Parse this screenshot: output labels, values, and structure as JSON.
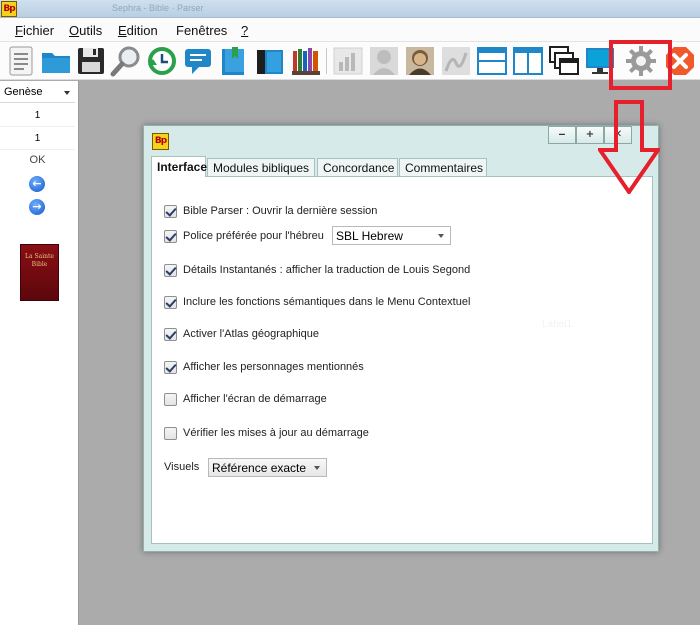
{
  "window": {
    "logo_text": "Bp",
    "ghost_title": "Sephra - Bible  ·  Parser"
  },
  "menu": [
    {
      "underlined": "F",
      "rest": "ichier"
    },
    {
      "underlined": "O",
      "rest": "utils"
    },
    {
      "underlined": "E",
      "rest": "dition"
    },
    {
      "underlined": "",
      "rest": "Fenêtres"
    },
    {
      "underlined": "?",
      "rest": ""
    }
  ],
  "toolbar": {
    "icons": [
      "document-icon",
      "folder-icon",
      "save-icon",
      "search-icon",
      "history-clock-icon",
      "comment-bubble-icon",
      "bookmark-book-icon",
      "books-icon",
      "library-books-icon",
      "chart-icon",
      "portrait-icon",
      "person-portrait-icon",
      "sketch-icon",
      "single-window-icon",
      "split-window-icon",
      "cascade-windows-icon",
      "monitor-icon",
      "gear-icon",
      "close-icon"
    ],
    "colors": {
      "blue": "#1f86c8",
      "green": "#2ba04a",
      "red_close": "#f0592a"
    }
  },
  "left_panel": {
    "book": "Genèse",
    "chapter": "1",
    "verse": "1",
    "ok_label": "OK",
    "bible_cover_line1": "La Sainte",
    "bible_cover_line2": "Bible"
  },
  "dialog": {
    "logo_text": "Bp",
    "window_buttons": [
      "‒",
      "+",
      "✕"
    ],
    "tabs": [
      "Interface",
      "Modules bibliques",
      "Concordance",
      "Commentaires"
    ],
    "active_tab": "Interface",
    "options": [
      {
        "label": "Bible Parser : Ouvrir la dernière session",
        "checked": true
      },
      {
        "label": "Police préférée pour l'hébreu",
        "checked": true
      },
      {
        "label": "Détails Instantanés : afficher la traduction de Louis Segond",
        "checked": true
      },
      {
        "label": "Inclure les fonctions sémantiques dans le Menu Contextuel",
        "checked": true
      },
      {
        "label": "Activer l'Atlas géographique",
        "checked": true
      },
      {
        "label": "Afficher les personnages mentionnés",
        "checked": true
      },
      {
        "label": "Afficher l'écran de démarrage",
        "checked": false
      },
      {
        "label": "Vérifier les mises à jour au démarrage",
        "checked": false
      }
    ],
    "hebrew_font": "SBL Hebrew",
    "visuels_label": "Visuels",
    "visuels_value": "Référence exacte",
    "ghost_label": "Label1"
  },
  "annotation": {
    "color": "#e5202c"
  }
}
